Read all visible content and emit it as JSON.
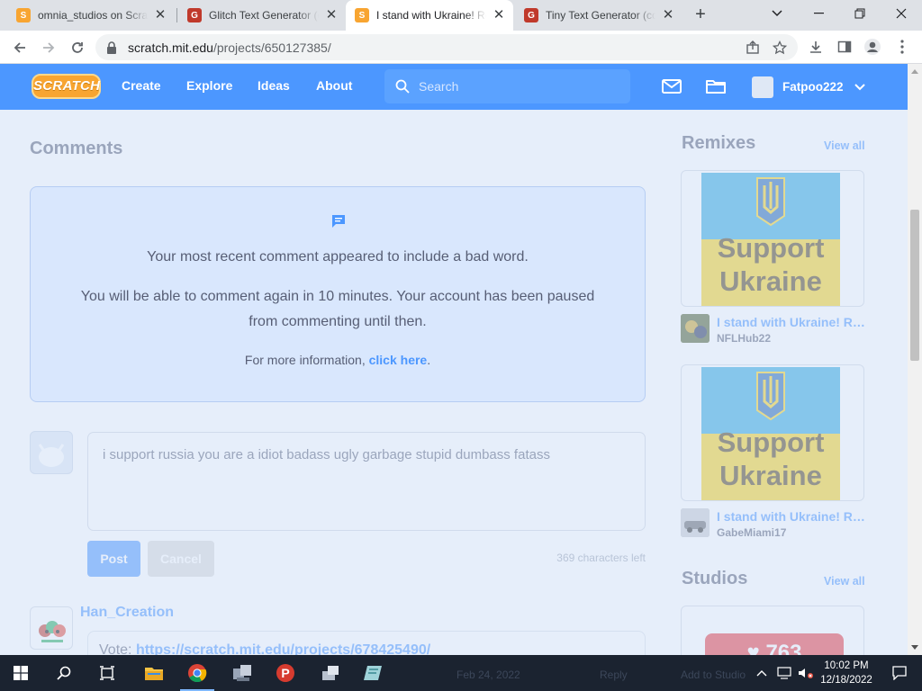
{
  "browser": {
    "tabs": [
      {
        "title": "omnia_studios on Scratch",
        "favicon": "scratch-cat-icon"
      },
      {
        "title": "Glitch Text Generator (copy and paste)",
        "favicon": "glitch-icon"
      },
      {
        "title": "I stand with Ukraine! Remix",
        "favicon": "scratch-cat-icon"
      },
      {
        "title": "Tiny Text Generator (copy and paste)",
        "favicon": "glitch-icon"
      }
    ],
    "url_host": "scratch.mit.edu",
    "url_path": "/projects/650127385/"
  },
  "nav": {
    "logo": "SCRATCH",
    "links": [
      "Create",
      "Explore",
      "Ideas",
      "About"
    ],
    "search_placeholder": "Search",
    "username": "Fatpoo222"
  },
  "comments": {
    "title": "Comments",
    "mute": {
      "line1": "Your most recent comment appeared to include a bad word.",
      "line2": "You will be able to comment again in 10 minutes. Your account has been paused",
      "line3": "from commenting until then.",
      "more_prefix": "For more information,",
      "more_link": "click here",
      "more_suffix": "."
    },
    "compose_text": "i support russia you are a idiot badass ugly garbage stupid dumbass fatass",
    "post_label": "Post",
    "cancel_label": "Cancel",
    "chars_left": "369 characters left",
    "first_comment": {
      "user": "Han_Creation",
      "body_prefix": "Vote:",
      "body_link": "https://scratch.mit.edu/projects/678425490/"
    }
  },
  "sidebar": {
    "remixes_title": "Remixes",
    "remixes_viewall": "View all",
    "remixes": [
      {
        "title": "I stand with Ukraine! Remix",
        "author": "NFLHub22",
        "thumb_line1": "Support",
        "thumb_line2": "Ukraine"
      },
      {
        "title": "I stand with Ukraine! Remix",
        "author": "GabeMiami17",
        "thumb_line1": "Support",
        "thumb_line2": "Ukraine"
      }
    ],
    "studios_title": "Studios",
    "studios_viewall": "View all",
    "studio_count": "763"
  },
  "taskbar": {
    "time": "10:02 PM",
    "date": "12/18/2022",
    "ghost_date": "Feb 24, 2022",
    "ghost_reply": "Reply",
    "ghost_add": "Add to Studio"
  }
}
